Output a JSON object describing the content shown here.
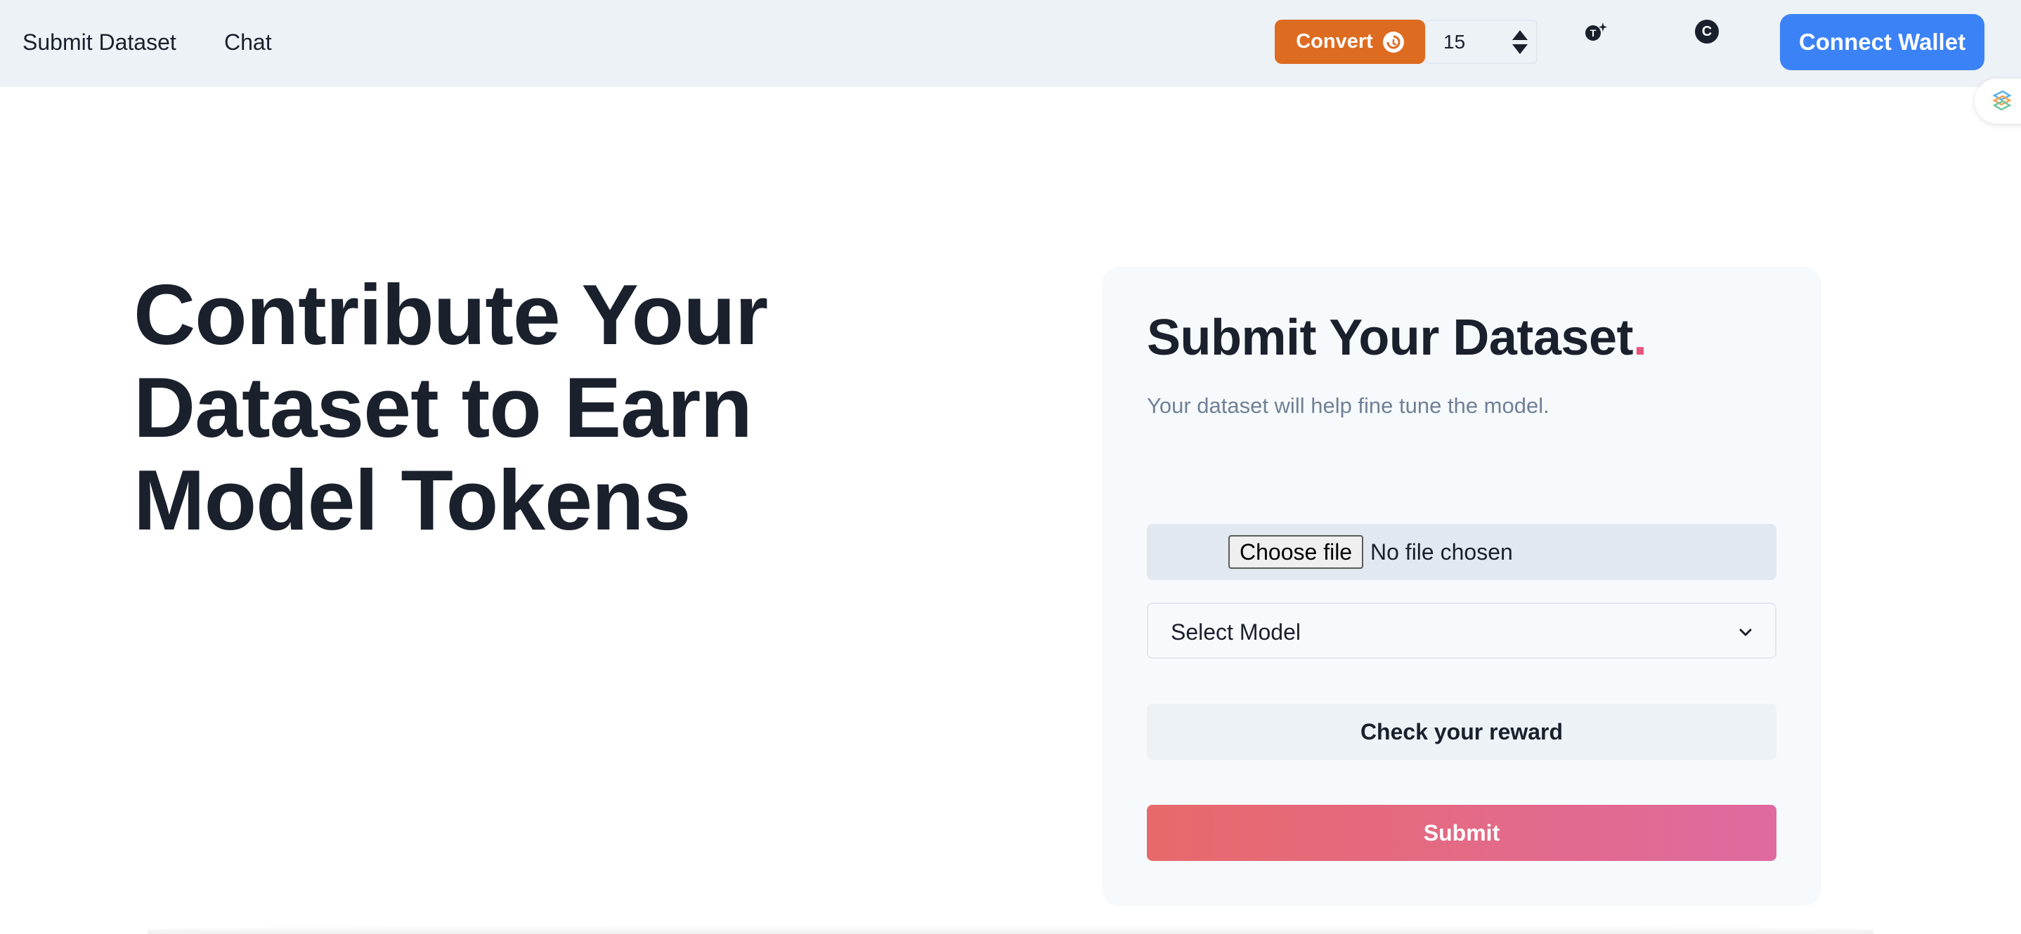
{
  "nav": {
    "links": [
      "Submit Dataset",
      "Chat"
    ],
    "convert_label": "Convert",
    "stepper_value": "15",
    "account_initial": "C",
    "connect_label": "Connect Wallet"
  },
  "hero": {
    "lines": [
      "Contribute Your",
      "Dataset to Earn",
      "Model Tokens"
    ]
  },
  "card": {
    "title": "Submit Your Dataset",
    "title_dot": ".",
    "subtitle": "Your dataset will help fine tune the model.",
    "file_button_label": "Choose file",
    "file_status": "No file chosen",
    "select_placeholder": "Select Model",
    "reward_label": "Check your reward",
    "submit_label": "Submit"
  },
  "colors": {
    "navbar_bg": "#edf2f7",
    "convert": "#dd6b20",
    "connect": "#3b82f6",
    "accent_dot": "#e9547a",
    "submit_start": "#e8696b",
    "submit_end": "#df6aa0"
  },
  "icons": {
    "convert": "refresh-icon",
    "token": "token-sparkle-icon",
    "account": "account-c-icon",
    "extension": "extension-icon",
    "select": "chevron-down-icon"
  }
}
